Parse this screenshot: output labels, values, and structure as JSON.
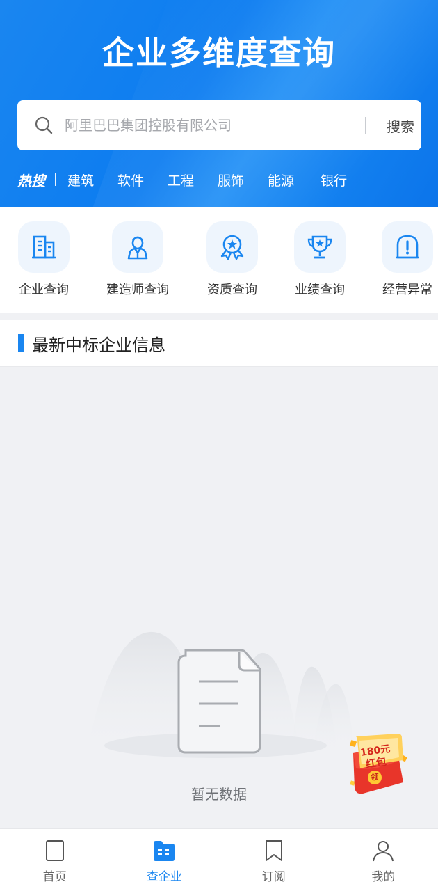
{
  "header": {
    "title": "企业多维度查询",
    "search": {
      "placeholder": "阿里巴巴集团控股有限公司",
      "button_label": "搜索"
    },
    "hot": {
      "label": "热搜",
      "items": [
        "建筑",
        "软件",
        "工程",
        "服饰",
        "能源",
        "银行"
      ]
    }
  },
  "quick_actions": [
    {
      "label": "企业查询",
      "icon": "building-icon"
    },
    {
      "label": "建造师查询",
      "icon": "person-icon"
    },
    {
      "label": "资质查询",
      "icon": "badge-icon"
    },
    {
      "label": "业绩查询",
      "icon": "trophy-icon"
    },
    {
      "label": "经营异常",
      "icon": "alert-icon"
    }
  ],
  "section": {
    "title": "最新中标企业信息"
  },
  "empty_state": {
    "text": "暂无数据"
  },
  "promo": {
    "amount": "180元",
    "name": "红包",
    "claim": "领"
  },
  "tabbar": [
    {
      "label": "首页",
      "icon": "home-icon",
      "active": false
    },
    {
      "label": "查企业",
      "icon": "company-icon",
      "active": true
    },
    {
      "label": "订阅",
      "icon": "bookmark-icon",
      "active": false
    },
    {
      "label": "我的",
      "icon": "user-icon",
      "active": false
    }
  ],
  "colors": {
    "accent": "#1a86f0",
    "background": "#f0f1f4",
    "promo": "#e8352a"
  }
}
